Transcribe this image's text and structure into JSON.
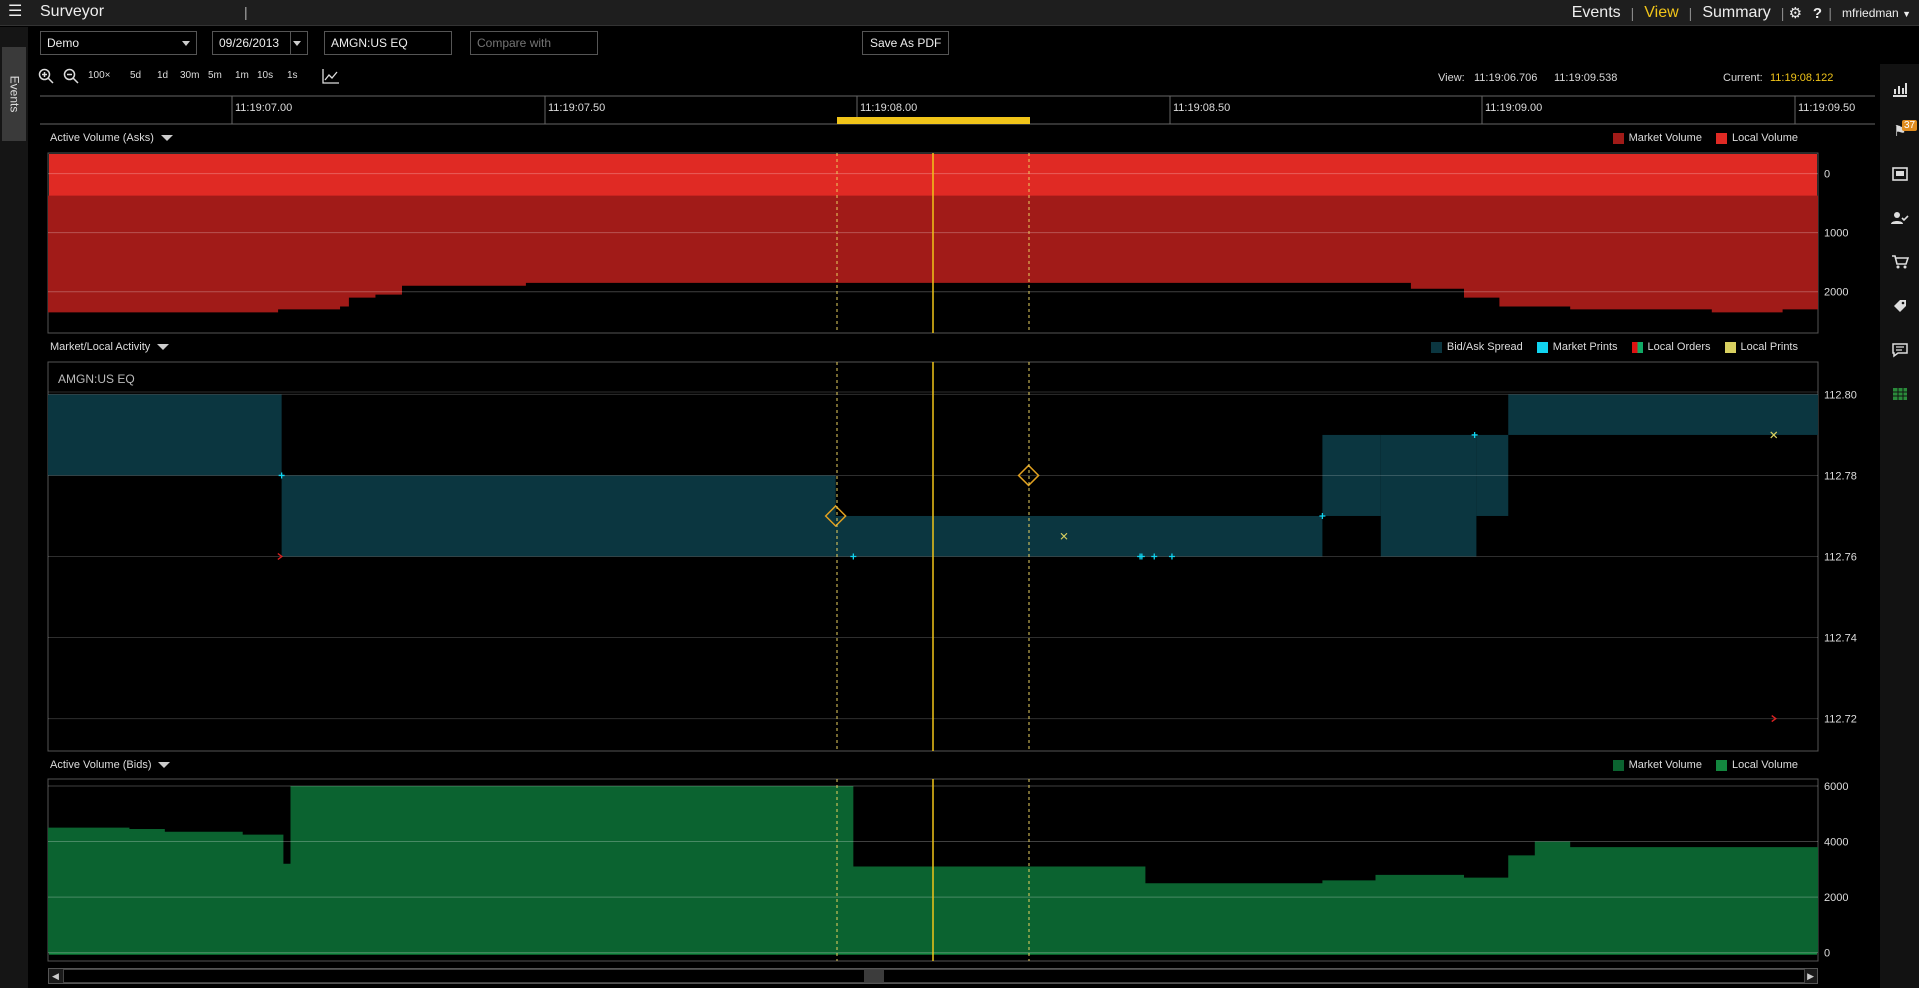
{
  "app": {
    "title": "Surveyor",
    "separator": "|"
  },
  "nav": {
    "events": "Events",
    "view": "View",
    "summary": "Summary",
    "user": "mfriedman"
  },
  "sidebar": {
    "events_tab": "Events",
    "badge_count": "37"
  },
  "toolbar": {
    "account": "Demo",
    "date": "09/26/2013",
    "symbol": "AMGN:US EQ",
    "compare_placeholder": "Compare with",
    "save_pdf": "Save As PDF"
  },
  "zoom": {
    "items": [
      "100×",
      "5d",
      "1d",
      "30m",
      "5m",
      "1m",
      "10s",
      "1s"
    ]
  },
  "view_info": {
    "view_label": "View:",
    "view_start": "11:19:06.706",
    "view_end": "11:19:09.538",
    "current_label": "Current:",
    "current_value": "11:19:08.122"
  },
  "timeline": {
    "ticks": [
      "11:19:07.00",
      "11:19:07.50",
      "11:19:08.00",
      "11:19:08.50",
      "11:19:09.00",
      "11:19:09.50"
    ]
  },
  "panels": {
    "asks": {
      "title": "Active Volume (Asks)",
      "legend": [
        "Market Volume",
        "Local Volume"
      ],
      "legend_colors": [
        "#a11b18",
        "#e02a24"
      ]
    },
    "activity": {
      "title": "Market/Local Activity",
      "legend": [
        "Bid/Ask Spread",
        "Market Prints",
        "Local Orders",
        "Local Prints"
      ],
      "legend_colors": [
        "#0b3640",
        "#11d4f0",
        "split",
        "#d8d060"
      ],
      "symbol_label": "AMGN:US EQ"
    },
    "bids": {
      "title": "Active Volume (Bids)",
      "legend": [
        "Market Volume",
        "Local Volume"
      ],
      "legend_colors": [
        "#0b6330",
        "#13873f"
      ]
    }
  },
  "chart_data": [
    {
      "type": "area",
      "title": "Active Volume (Asks)",
      "y_ticks": [
        "0",
        "1000",
        "2000"
      ],
      "ylim": [
        -350,
        2700
      ],
      "y_inverted": true,
      "series": [
        {
          "name": "Market Volume",
          "x": [
            0,
            0.13,
            0.165,
            0.17,
            0.185,
            0.2,
            0.27,
            0.445,
            0.5,
            0.72,
            0.77,
            0.8,
            0.82,
            0.86,
            0.9,
            0.94,
            0.98,
            1.0
          ],
          "values": [
            2350,
            2300,
            2250,
            2100,
            2050,
            1900,
            1850,
            1850,
            1850,
            1850,
            1950,
            2100,
            2250,
            2300,
            2300,
            2350,
            2300,
            2250
          ]
        }
      ]
    },
    {
      "type": "area",
      "title": "Market/Local Activity",
      "y_ticks": [
        "112.80",
        "112.78",
        "112.76",
        "112.74",
        "112.72"
      ],
      "ylim": [
        112.712,
        112.808
      ],
      "series": [
        {
          "name": "Bid/Ask Spread",
          "segments": [
            {
              "x0": 0.0,
              "x1": 0.132,
              "bid": 112.78,
              "ask": 112.8
            },
            {
              "x0": 0.132,
              "x1": 0.445,
              "bid": 112.76,
              "ask": 112.78
            },
            {
              "x0": 0.445,
              "x1": 0.72,
              "bid": 112.76,
              "ask": 112.77
            },
            {
              "x0": 0.72,
              "x1": 0.753,
              "bid": 112.77,
              "ask": 112.79
            },
            {
              "x0": 0.753,
              "x1": 0.807,
              "bid": 112.76,
              "ask": 112.79
            },
            {
              "x0": 0.807,
              "x1": 0.825,
              "bid": 112.77,
              "ask": 112.79
            },
            {
              "x0": 0.825,
              "x1": 1.0,
              "bid": 112.79,
              "ask": 112.8
            }
          ]
        },
        {
          "name": "Market Prints",
          "x": [
            0.132,
            0.455,
            0.617,
            0.618,
            0.625,
            0.635,
            0.72,
            0.806
          ],
          "values": [
            112.78,
            112.76,
            112.76,
            112.76,
            112.76,
            112.76,
            112.77,
            112.79
          ]
        },
        {
          "name": "Local Orders",
          "x": [
            0.131,
            0.445,
            0.554,
            0.975
          ],
          "values": [
            112.76,
            112.77,
            112.78,
            112.72
          ]
        },
        {
          "name": "Local Prints",
          "x": [
            0.574,
            0.975
          ],
          "values": [
            112.765,
            112.79
          ]
        }
      ]
    },
    {
      "type": "area",
      "title": "Active Volume (Bids)",
      "y_ticks": [
        "6000",
        "4000",
        "2000",
        "0"
      ],
      "ylim": [
        -300,
        6250
      ],
      "series": [
        {
          "name": "Market Volume",
          "x": [
            0,
            0.046,
            0.066,
            0.11,
            0.133,
            0.137,
            0.453,
            0.455,
            0.6,
            0.62,
            0.72,
            0.75,
            0.8,
            0.825,
            0.84,
            0.86,
            0.9,
            1.0
          ],
          "values": [
            4500,
            4450,
            4350,
            4250,
            3200,
            6000,
            6000,
            3100,
            3100,
            2500,
            2600,
            2800,
            2700,
            3500,
            4000,
            3800,
            3800,
            3700
          ]
        }
      ]
    }
  ]
}
